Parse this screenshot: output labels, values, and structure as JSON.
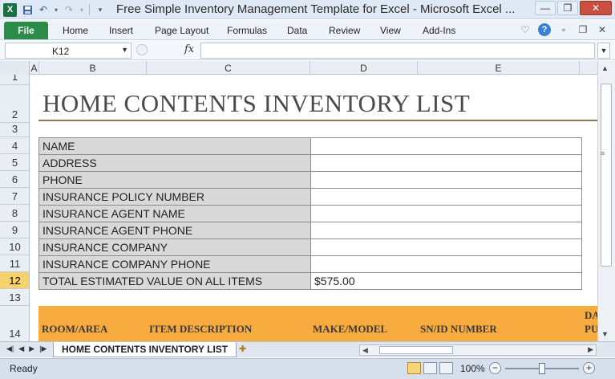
{
  "window": {
    "title": "Free Simple Inventory Management Template for Excel  -  Microsoft Excel ...",
    "app_icon_letter": "X"
  },
  "ribbon": {
    "file_label": "File",
    "tabs": [
      "Home",
      "Insert",
      "Page Layout",
      "Formulas",
      "Data",
      "Review",
      "View",
      "Add-Ins"
    ]
  },
  "formula_bar": {
    "name_box": "K12",
    "fx_label": "fx",
    "formula": ""
  },
  "columns": [
    "A",
    "B",
    "C",
    "D",
    "E"
  ],
  "rows": [
    "1",
    "2",
    "3",
    "4",
    "5",
    "6",
    "7",
    "8",
    "9",
    "10",
    "11",
    "12",
    "13",
    "14"
  ],
  "active_row": "12",
  "sheet": {
    "title": "HOME CONTENTS INVENTORY LIST",
    "info": [
      {
        "label": "NAME",
        "value": ""
      },
      {
        "label": "ADDRESS",
        "value": ""
      },
      {
        "label": "PHONE",
        "value": ""
      },
      {
        "label": "INSURANCE POLICY NUMBER",
        "value": ""
      },
      {
        "label": "INSURANCE AGENT NAME",
        "value": ""
      },
      {
        "label": "INSURANCE AGENT PHONE",
        "value": ""
      },
      {
        "label": "INSURANCE COMPANY",
        "value": ""
      },
      {
        "label": "INSURANCE COMPANY PHONE",
        "value": ""
      },
      {
        "label": "TOTAL ESTIMATED VALUE ON ALL ITEMS",
        "value": "$575.00"
      }
    ],
    "table_headers": [
      "ROOM/AREA",
      "ITEM DESCRIPTION",
      "MAKE/MODEL",
      "SN/ID NUMBER"
    ],
    "cut_header_top": "DA",
    "cut_header_bottom": "PU"
  },
  "sheet_tab": "HOME CONTENTS INVENTORY LIST",
  "status": {
    "text": "Ready",
    "zoom": "100%"
  },
  "colors": {
    "header_band": "#f8ac3f",
    "label_fill": "#d9d9d9",
    "file_tab": "#2a8c46",
    "active_row": "#f7d26a"
  }
}
